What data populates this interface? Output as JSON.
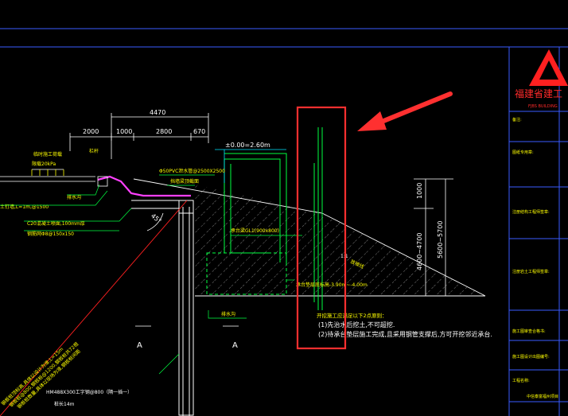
{
  "colors": {
    "background": "#000000",
    "frame": "#3a5bff",
    "dimension": "#ffffff",
    "annotation": "#ffff00",
    "structure": "#00ff40",
    "soil": "#ffffff",
    "pipe": "#ff40ff",
    "red_line": "#ff2020",
    "callout_box": "#ff3030",
    "cyan": "#00e5ff",
    "title_red": "#ff2a2a",
    "logo_red": "#ff2020"
  },
  "dimensions": {
    "total": "4470",
    "seg1": "2000",
    "seg2": "1000",
    "seg3": "2800",
    "seg4": "670",
    "v_top": "1000",
    "v_mid": "4600~4700",
    "v_right": "5600~5700"
  },
  "labels": {
    "level": "±0.00=2.60m",
    "load": "临时施工荷载",
    "load_value": "限载20kPa",
    "railing": "栏杆",
    "pipe_sleeve": "Φ50PVC泄水管@2500X2500",
    "retaining": "挡墙梁顶截面",
    "drain_ditch": "排水沟",
    "anchor": "土钉墙,L=1m,@1500",
    "shotcrete": "C20混凝土喷面,100mm厚",
    "mesh": "钢筋网Φ8@150x150",
    "angle": "45°",
    "beam": "承台梁GL1(900x800)",
    "slope_ratio": "1:1",
    "slope_note": "放坡线",
    "excavation": "承台垫层底标高-3.90m~-4.00m",
    "drain_bottom": "排水沟",
    "pile_long": "HM488X300工字钢@800（隔一插一）",
    "pile_len": "桩长14m",
    "diag_note1": "钢板桩顶标高,具体以设计为准,L=15m",
    "diag_note2": "钢板桩@800,钢板桩@1200,钢板桩共72根",
    "diag_note3": "钢板桩数量,具体以现场为准,钢板桩间距",
    "section_a1": "A",
    "section_a2": "A",
    "note_title": "开挖施工应满足以下2点原则：",
    "note_1": "(1)先治水后挖土,不可超挖.",
    "note_2": "(2)待承台垫层施工完成,且采用钢管支撑后,方可开挖邻近承台."
  },
  "title_block": {
    "company": "福建省建工",
    "company_sub": "FJBS BUILDING",
    "rows": [
      "备注:",
      "图纸专用章:",
      "注册结构工程师签章:",
      "注册岩土工程师签章:",
      "施工图审查合格书:",
      "施工图设计出图编号:",
      "工程名称:",
      "中信泰富福州项目"
    ]
  }
}
